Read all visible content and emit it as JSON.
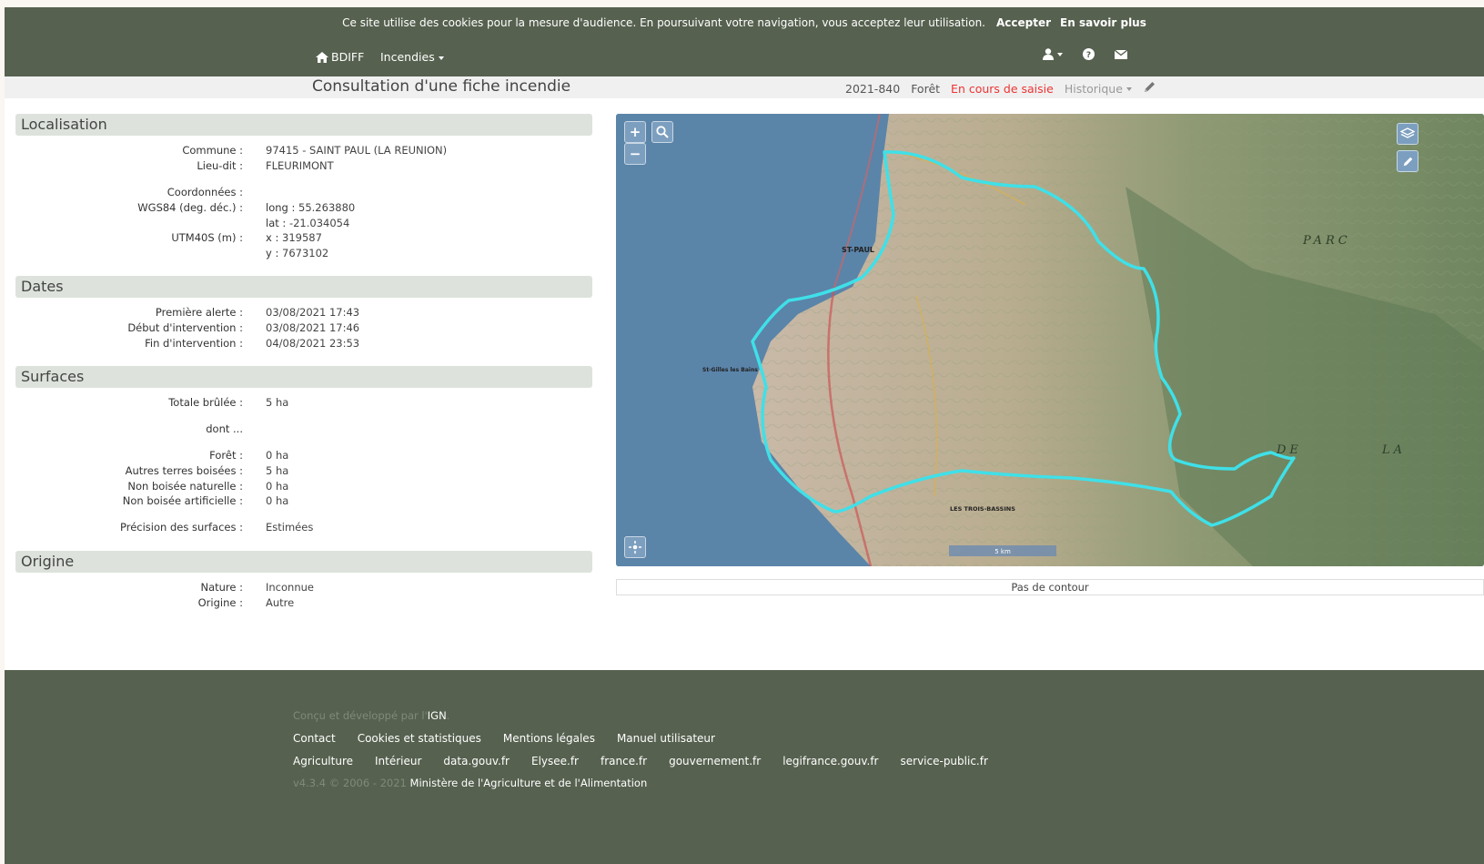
{
  "cookie": {
    "text": "Ce site utilise des cookies pour la mesure d'audience. En poursuivant votre navigation, vous acceptez leur utilisation.",
    "accept": "Accepter",
    "more": "En savoir plus"
  },
  "nav": {
    "home": "BDIFF",
    "incendies": "Incendies"
  },
  "header": {
    "title": "Consultation d'une fiche incendie",
    "id": "2021-840",
    "type": "Forêt",
    "status": "En cours de saisie",
    "history": "Historique"
  },
  "localisation": {
    "title": "Localisation",
    "commune_label": "Commune :",
    "commune": "97415 - SAINT PAUL (LA REUNION)",
    "lieu_label": "Lieu-dit :",
    "lieu": "FLEURIMONT",
    "coords_label": "Coordonnées :",
    "wgs_label": "WGS84 (deg. déc.) :",
    "long_label": "long :",
    "long": "55.263880",
    "lat_label": "lat :",
    "lat": "-21.034054",
    "utm_label": "UTM40S (m) :",
    "x_label": "x :",
    "x": "319587",
    "y_label": "y :",
    "y": "7673102"
  },
  "dates": {
    "title": "Dates",
    "alerte_label": "Première alerte :",
    "alerte": "03/08/2021 17:43",
    "debut_label": "Début d'intervention :",
    "debut": "03/08/2021 17:46",
    "fin_label": "Fin d'intervention :",
    "fin": "04/08/2021 23:53"
  },
  "surfaces": {
    "title": "Surfaces",
    "totale_label": "Totale brûlée :",
    "totale": "5 ha",
    "dont_label": "dont ...",
    "foret_label": "Forêt :",
    "foret": "0 ha",
    "autres_label": "Autres terres boisées :",
    "autres": "5 ha",
    "nbn_label": "Non boisée naturelle :",
    "nbn": "0 ha",
    "nba_label": "Non boisée artificielle :",
    "nba": "0 ha",
    "precision_label": "Précision des surfaces :",
    "precision": "Estimées"
  },
  "origine": {
    "title": "Origine",
    "nature_label": "Nature :",
    "nature": "Inconnue",
    "origine_label": "Origine :",
    "origine": "Autre"
  },
  "map": {
    "place1": "ST-PAUL",
    "place2": "St-Gilles les Bains",
    "place3": "LES TROIS-BASSINS",
    "place4": "PARC",
    "place5": "DE",
    "place6": "LA",
    "scale": "5 km",
    "no_contour": "Pas de contour",
    "outline_color": "#3fe0e8"
  },
  "footer": {
    "credit_prefix": "Conçu et développé par l'",
    "credit_org": "IGN",
    "credit_suffix": ".",
    "links1": [
      "Contact",
      "Cookies et statistiques",
      "Mentions légales",
      "Manuel utilisateur"
    ],
    "links2": [
      "Agriculture",
      "Intérieur",
      "data.gouv.fr",
      "Elysee.fr",
      "france.fr",
      "gouvernement.fr",
      "legifrance.gouv.fr",
      "service-public.fr"
    ],
    "version": "v4.3.4 © 2006 - 2021",
    "ministry": "Ministère de l'Agriculture et de l'Alimentation"
  }
}
